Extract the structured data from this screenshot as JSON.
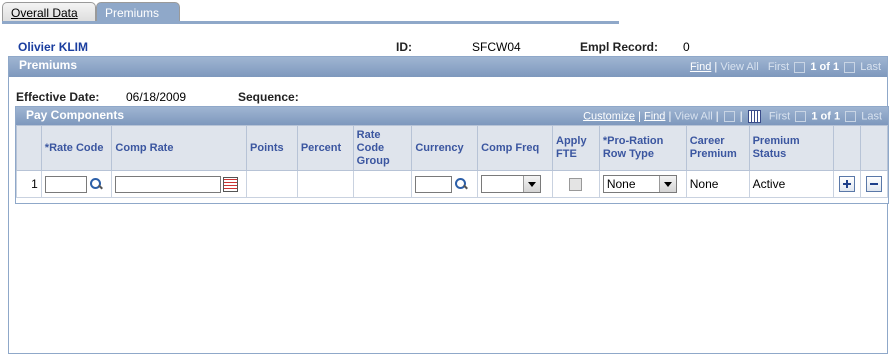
{
  "tabs": [
    {
      "label": "Overall Data",
      "active": false
    },
    {
      "label": "Premiums",
      "active": true
    }
  ],
  "header": {
    "employee_name": "Olivier KLIM",
    "id_label": "ID:",
    "id_value": "SFCW04",
    "empl_record_label": "Empl Record:",
    "empl_record_value": "0"
  },
  "premiums": {
    "title": "Premiums",
    "nav": {
      "find": "Find",
      "view_all": "View All",
      "first": "First",
      "counter": "1 of 1",
      "last": "Last"
    },
    "effective_date_label": "Effective Date:",
    "effective_date_value": "06/18/2009",
    "sequence_label": "Sequence:"
  },
  "pay_components": {
    "title": "Pay Components",
    "nav": {
      "customize": "Customize",
      "find": "Find",
      "view_all": "View All",
      "first": "First",
      "counter": "1 of 1",
      "last": "Last"
    },
    "columns": [
      "*Rate Code",
      "Comp Rate",
      "Points",
      "Percent",
      "Rate Code Group",
      "Currency",
      "Comp Freq",
      "Apply FTE",
      "*Pro-Ration Row Type",
      "Career Premium",
      "Premium Status"
    ],
    "rows": [
      {
        "row_number": "1",
        "rate_code": "",
        "comp_rate": "",
        "points": "",
        "percent": "",
        "rate_code_group": "",
        "currency": "",
        "comp_freq": "",
        "apply_fte": false,
        "proration_row_type": "None",
        "career_premium": "None",
        "premium_status": "Active"
      }
    ]
  },
  "colors": {
    "header_bar": "#8fa8c9",
    "column_header_text": "#3b56a0",
    "employee_name": "#1a3e9f"
  }
}
